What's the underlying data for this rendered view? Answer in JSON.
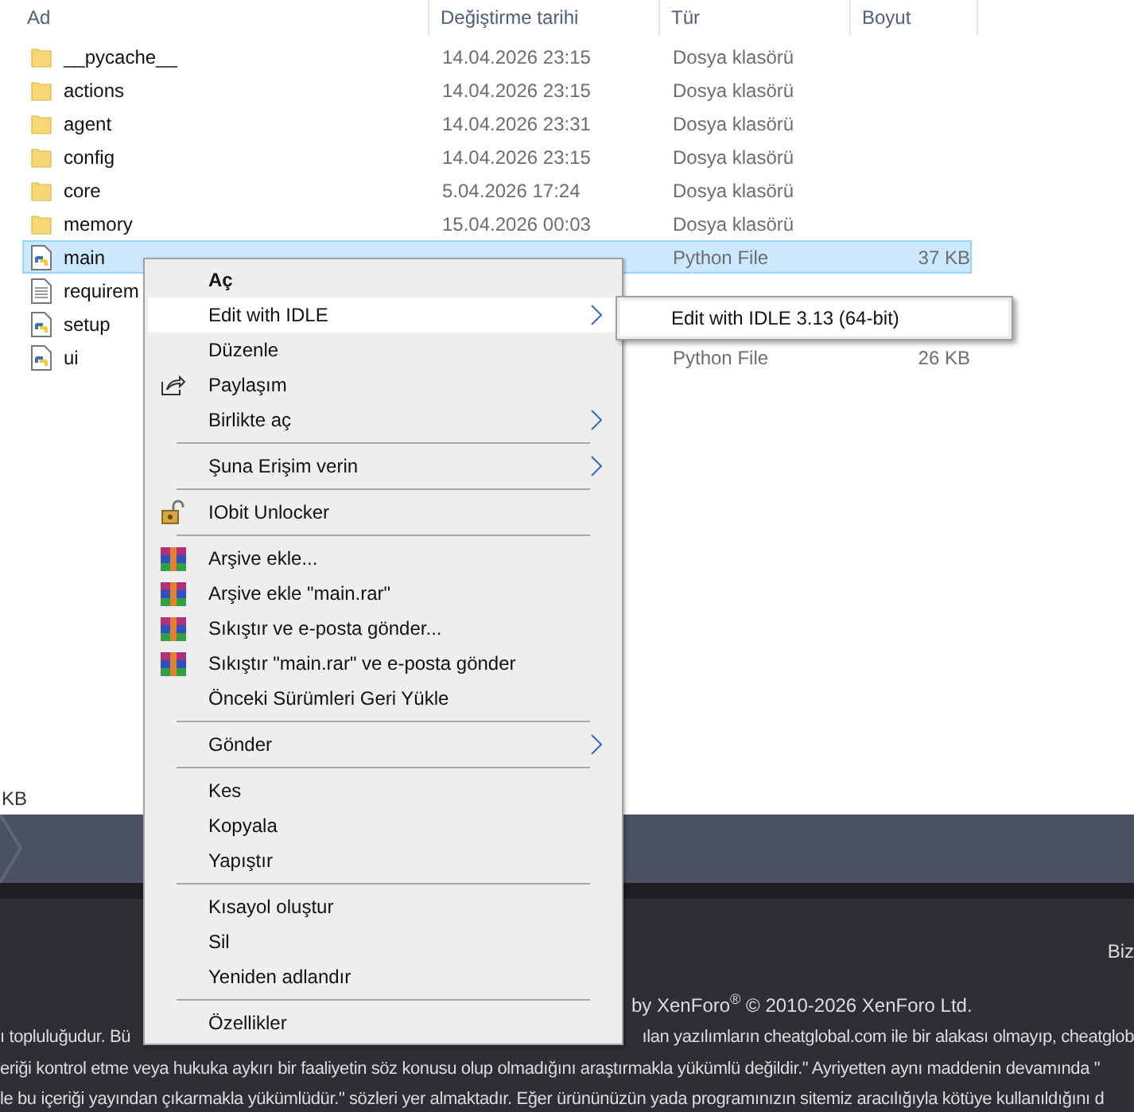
{
  "columns": [
    "Ad",
    "Değiştirme tarihi",
    "Tür",
    "Boyut"
  ],
  "files": [
    {
      "name": "__pycache__",
      "kind": "folder",
      "date": "14.04.2026 23:15",
      "type": "Dosya klasörü",
      "selected": false
    },
    {
      "name": "actions",
      "kind": "folder",
      "date": "14.04.2026 23:15",
      "type": "Dosya klasörü",
      "selected": false
    },
    {
      "name": "agent",
      "kind": "folder",
      "date": "14.04.2026 23:31",
      "type": "Dosya klasörü",
      "selected": false
    },
    {
      "name": "config",
      "kind": "folder",
      "date": "14.04.2026 23:15",
      "type": "Dosya klasörü",
      "selected": false
    },
    {
      "name": "core",
      "kind": "folder",
      "date": "5.04.2026 17:24",
      "type": "Dosya klasörü",
      "selected": false
    },
    {
      "name": "memory",
      "kind": "folder",
      "date": "15.04.2026 00:03",
      "type": "Dosya klasörü",
      "selected": false
    },
    {
      "name": "main",
      "kind": "python",
      "type": "Python File",
      "size": "37 KB",
      "selected": true
    },
    {
      "name": "requirem",
      "kind": "text",
      "selected": false
    },
    {
      "name": "setup",
      "kind": "python",
      "selected": false
    },
    {
      "name": "ui",
      "kind": "python",
      "type": "Python File",
      "size": "26 KB",
      "selected": false
    }
  ],
  "status_text": "KB",
  "context_menu": [
    {
      "kind": "item",
      "label": "Aç",
      "bold": true,
      "selected": false
    },
    {
      "kind": "item",
      "label": "Edit with IDLE",
      "submenu": true,
      "selected": true
    },
    {
      "kind": "item",
      "label": "Düzenle",
      "selected": false
    },
    {
      "kind": "share",
      "label": "Paylaşım",
      "selected": false
    },
    {
      "kind": "item",
      "label": "Birlikte aç",
      "submenu": true,
      "selected": false
    },
    {
      "kind": "separator"
    },
    {
      "kind": "item",
      "label": "Şuna Erişim verin",
      "submenu": true,
      "selected": false
    },
    {
      "kind": "separator"
    },
    {
      "kind": "lock",
      "label": "IObit Unlocker",
      "selected": false
    },
    {
      "kind": "separator"
    },
    {
      "kind": "archive",
      "label": "Arşive ekle...",
      "selected": false
    },
    {
      "kind": "archive",
      "label": "Arşive ekle \"main.rar\"",
      "selected": false
    },
    {
      "kind": "archive",
      "label": "Sıkıştır ve e-posta gönder...",
      "selected": false
    },
    {
      "kind": "archive",
      "label": "Sıkıştır \"main.rar\" ve e-posta gönder",
      "selected": false
    },
    {
      "kind": "item",
      "label": "Önceki Sürümleri Geri Yükle",
      "selected": false
    },
    {
      "kind": "separator"
    },
    {
      "kind": "item",
      "label": "Gönder",
      "submenu": true,
      "selected": false
    },
    {
      "kind": "separator"
    },
    {
      "kind": "item",
      "label": "Kes",
      "selected": false
    },
    {
      "kind": "item",
      "label": "Kopyala",
      "selected": false
    },
    {
      "kind": "item",
      "label": "Yapıştır",
      "selected": false
    },
    {
      "kind": "separator"
    },
    {
      "kind": "item",
      "label": "Kısayol oluştur",
      "selected": false
    },
    {
      "kind": "item",
      "label": "Sil",
      "selected": false
    },
    {
      "kind": "item",
      "label": "Yeniden adlandır",
      "selected": false
    },
    {
      "kind": "separator"
    },
    {
      "kind": "item",
      "label": "Özellikler",
      "selected": false
    }
  ],
  "submenu": [
    "Edit with IDLE 3.13 (64-bit)"
  ],
  "footer": {
    "link": "Biz",
    "credit": "by XenForo$^{®}$ © 2010-2026 XenForo Ltd.",
    "line_1_left": "ı topluluğudur. Bü",
    "line_1_right": "ılan yazılımların cheatglobal.com ile bir alakası olmayıp, cheatglob",
    "line_2": "eriği kontrol etme veya hukuka aykırı bir faaliyetin söz konusu olup olmadığını araştırmakla yükümlü değildir.\" Ayriyetten aynı maddenin devamında \"",
    "line_3": "le bu içeriği yayından çıkarmakla yükümlüdür.\" sözleri yer almaktadır. Eğer ürününüzün yada programınızın sitemiz aracılığıyla kötüye kullanıldığını d"
  }
}
